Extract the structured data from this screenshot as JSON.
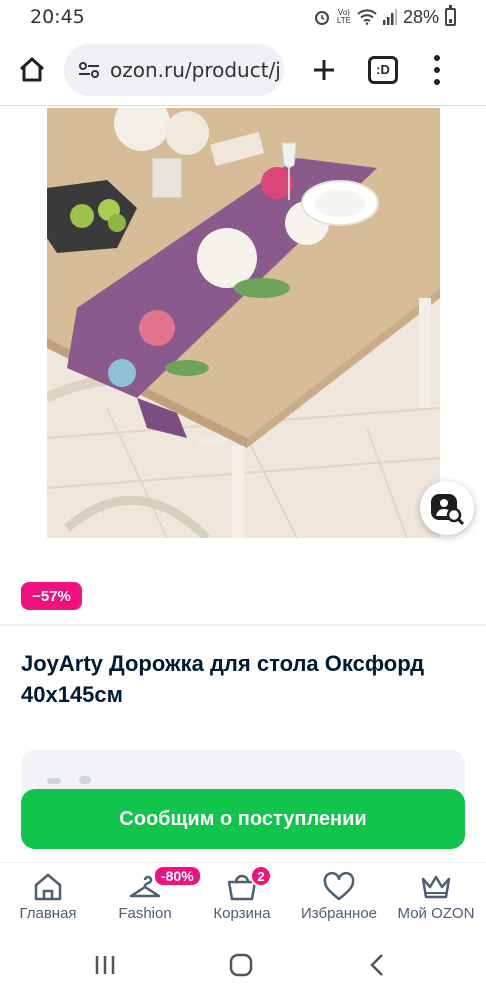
{
  "status": {
    "time": "20:45",
    "lte_label": "VoLTE",
    "battery": "28%"
  },
  "browser": {
    "url": "ozon.ru/product/j",
    "tabs_label": ":D"
  },
  "product": {
    "discount": "−57%",
    "title": "JoyArty Дорожка для стола Оксфорд 40х145см"
  },
  "actions": {
    "notify_label": "Сообщим о поступлении"
  },
  "tabbar": {
    "items": [
      {
        "label": "Главная",
        "icon": "home-icon"
      },
      {
        "label": "Fashion",
        "icon": "hanger-icon",
        "badge": "-80%"
      },
      {
        "label": "Корзина",
        "icon": "cart-icon",
        "badge": "2"
      },
      {
        "label": "Избранное",
        "icon": "heart-icon"
      },
      {
        "label": "Мой OZON",
        "icon": "crown-icon"
      }
    ]
  },
  "colors": {
    "accent_green": "#10c44c",
    "badge_pink": "#f1117e",
    "text_dark": "#001a34"
  }
}
